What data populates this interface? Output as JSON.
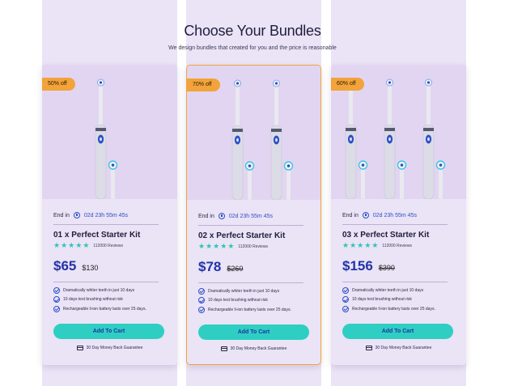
{
  "header": {
    "title": "Choose Your Bundles",
    "subtitle": "We design bundles that created for you and the price is reasonable"
  },
  "colors": {
    "accent_teal": "#2ecfc2",
    "price_blue": "#2233a8",
    "badge_orange": "#f2a33a",
    "card_bg": "#ebe3f6"
  },
  "bundles": [
    {
      "badge": "50% off",
      "brush_count": 1,
      "ends_label": "End in",
      "countdown": "02d 23h 55m 45s",
      "name": "01 x Perfect Starter Kit",
      "rating": 5,
      "reviews": "112000 Reviews",
      "price": "$65",
      "old_price": "$130",
      "old_price_struck": false,
      "features": [
        "Dramatically whiter teeth in just 10 days",
        "10 days test brushing without risk",
        "Rechargeable li-ion battery lasts over 25 days."
      ],
      "cta": "Add To Cart",
      "guarantee": "30 Day Money Back Guarantee",
      "featured": false
    },
    {
      "badge": "70% off",
      "brush_count": 2,
      "ends_label": "End in",
      "countdown": "02d 23h 55m 45s",
      "name": "02 x Perfect Starter Kit",
      "rating": 5,
      "reviews": "112000 Reviews",
      "price": "$78",
      "old_price": "$260",
      "old_price_struck": true,
      "features": [
        "Dramatically whiter teeth in just 10 days",
        "10 days test brushing without risk",
        "Rechargeable li-ion battery lasts over 25 days."
      ],
      "cta": "Add To Cart",
      "guarantee": "30 Day Money Back Guarantee",
      "featured": true
    },
    {
      "badge": "60% off",
      "brush_count": 3,
      "ends_label": "End in",
      "countdown": "02d 23h 55m 45s",
      "name": "03 x Perfect Starter Kit",
      "rating": 5,
      "reviews": "112000 Reviews",
      "price": "$156",
      "old_price": "$390",
      "old_price_struck": true,
      "features": [
        "Dramatically whiter teeth in just 10 days",
        "10 days test brushing without risk",
        "Rechargeable li-ion battery lasts over 25 days."
      ],
      "cta": "Add To Cart",
      "guarantee": "30 Day Money Back Guarantee",
      "featured": false
    }
  ]
}
